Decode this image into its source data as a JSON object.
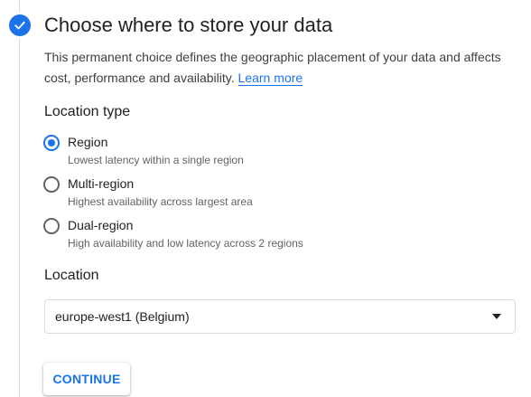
{
  "step": {
    "title": "Choose where to store your data",
    "completed": true,
    "description": "This permanent choice defines the geographic placement of your data and affects cost, performance and availability.",
    "learn_more_label": "Learn more"
  },
  "location_type": {
    "heading": "Location type",
    "selected": "Region",
    "options": [
      {
        "label": "Region",
        "help": "Lowest latency within a single region",
        "checked": true
      },
      {
        "label": "Multi-region",
        "help": "Highest availability across largest area",
        "checked": false
      },
      {
        "label": "Dual-region",
        "help": "High availability and low latency across 2 regions",
        "checked": false
      }
    ]
  },
  "location": {
    "heading": "Location",
    "selected_value": "europe-west1 (Belgium)"
  },
  "actions": {
    "continue_label": "CONTINUE"
  },
  "colors": {
    "accent": "#1a73e8",
    "text_primary": "#202124",
    "text_secondary": "#5f6368",
    "border": "#dadce0"
  },
  "icons": {
    "step_status": "check-icon",
    "select_arrow": "caret-down-icon"
  }
}
